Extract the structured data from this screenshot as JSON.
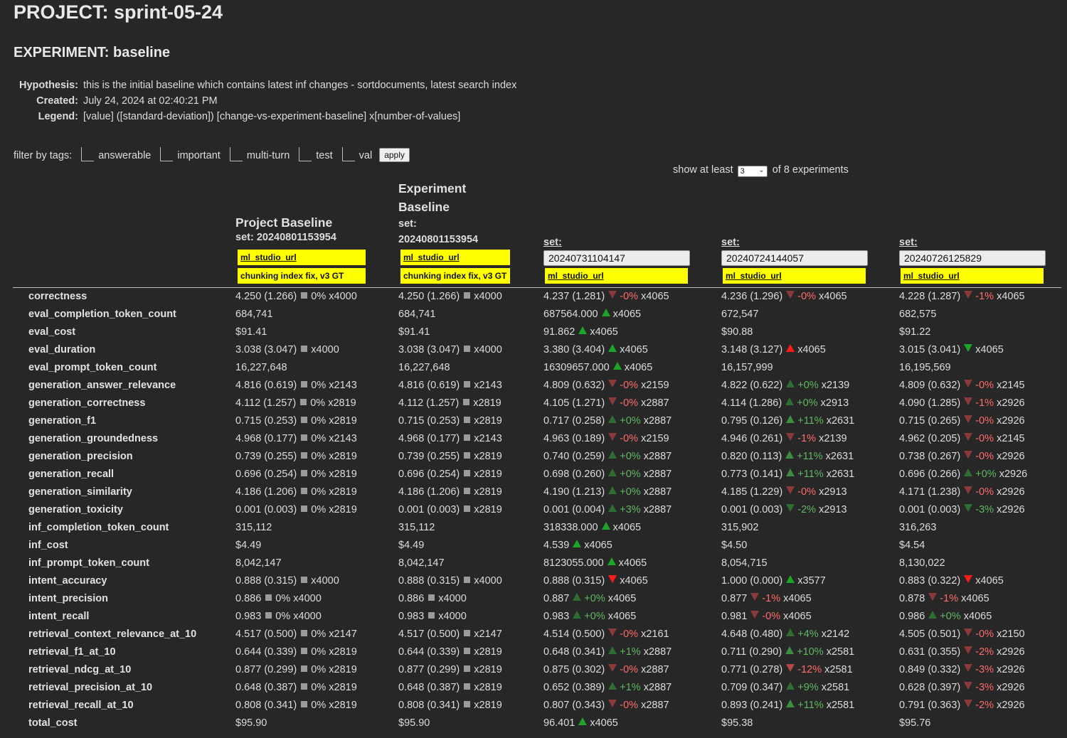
{
  "project": {
    "label": "PROJECT: sprint-05-24"
  },
  "experiment": {
    "label": "EXPERIMENT: baseline"
  },
  "meta": [
    {
      "key": "Hypothesis:",
      "value": "this is the initial baseline which contains latest inf changes - sortdocuments, latest search index"
    },
    {
      "key": "Created:",
      "value": "July 24, 2024 at 02:40:21 PM"
    },
    {
      "key": "Legend:",
      "value": "[value] ([standard-deviation]) [change-vs-experiment-baseline] x[number-of-values]"
    }
  ],
  "filter": {
    "label": "filter by tags:",
    "tags": [
      "answerable",
      "important",
      "multi-turn",
      "test",
      "val"
    ],
    "apply_label": "apply"
  },
  "show": {
    "prefix": "show at least",
    "selected": "3",
    "suffix": "of 8 experiments"
  },
  "columns": [
    {
      "title_line1": "Project Baseline",
      "title_line2": "",
      "set_label": "set: 20240801153954",
      "set_value": "",
      "url_label": "ml_studio_url",
      "note": "chunking index fix, v3 GT"
    },
    {
      "title_line1": "Experiment",
      "title_line2": "Baseline",
      "set_label": "set:",
      "set_value": "20240801153954",
      "url_label": "ml_studio_url",
      "note": "chunking index fix, v3 GT"
    },
    {
      "set_label": "set:",
      "set_value": "20240731104147",
      "url_label": "ml_studio_url"
    },
    {
      "set_label": "set:",
      "set_value": "20240724144057",
      "url_label": "ml_studio_url"
    },
    {
      "set_label": "set:",
      "set_value": "20240726125829",
      "url_label": "ml_studio_url"
    }
  ],
  "colors": {
    "background": "#272727",
    "yellow": "#ffff00",
    "green": "#1fa42a",
    "red": "#ff1a1a",
    "neutral": "#9b9b9b"
  },
  "rows": [
    {
      "metric": "correctness",
      "cells": [
        {
          "value": "4.250 (1.266)",
          "marker": "square",
          "pct": "0%",
          "count": "x4000"
        },
        {
          "value": "4.250 (1.266)",
          "marker": "square",
          "pct": "",
          "count": "x4000"
        },
        {
          "value": "4.237 (1.281)",
          "marker": "down-dim",
          "pct": "-0%",
          "count": "x4065"
        },
        {
          "value": "4.236 (1.296)",
          "marker": "down-dim",
          "pct": "-0%",
          "count": "x4065"
        },
        {
          "value": "4.228 (1.287)",
          "marker": "down-dim",
          "pct": "-1%",
          "count": "x4065"
        }
      ]
    },
    {
      "metric": "eval_completion_token_count",
      "cells": [
        {
          "value": "684,741"
        },
        {
          "value": "684,741"
        },
        {
          "value": "687564.000",
          "marker": "up-bright",
          "pct": "",
          "count": "x4065"
        },
        {
          "value": "672,547"
        },
        {
          "value": "682,575"
        }
      ]
    },
    {
      "metric": "eval_cost",
      "cells": [
        {
          "value": "$91.41"
        },
        {
          "value": "$91.41"
        },
        {
          "value": "91.862",
          "marker": "up-bright",
          "pct": "",
          "count": "x4065"
        },
        {
          "value": "$90.88"
        },
        {
          "value": "$91.22"
        }
      ]
    },
    {
      "metric": "eval_duration",
      "cells": [
        {
          "value": "3.038 (3.047)",
          "marker": "square",
          "pct": "",
          "count": "x4000"
        },
        {
          "value": "3.038 (3.047)",
          "marker": "square",
          "pct": "",
          "count": "x4000"
        },
        {
          "value": "3.380 (3.404)",
          "marker": "up-bright",
          "pct": "",
          "count": "x4065"
        },
        {
          "value": "3.148 (3.127)",
          "marker": "up-red",
          "pct": "",
          "count": "x4065"
        },
        {
          "value": "3.015 (3.041)",
          "marker": "down-green",
          "pct": "",
          "count": "x4065"
        }
      ]
    },
    {
      "metric": "eval_prompt_token_count",
      "cells": [
        {
          "value": "16,227,648"
        },
        {
          "value": "16,227,648"
        },
        {
          "value": "16309657.000",
          "marker": "up-bright",
          "pct": "",
          "count": "x4065"
        },
        {
          "value": "16,157,999"
        },
        {
          "value": "16,195,569"
        }
      ]
    },
    {
      "metric": "generation_answer_relevance",
      "cells": [
        {
          "value": "4.816 (0.619)",
          "marker": "square",
          "pct": "0%",
          "count": "x2143"
        },
        {
          "value": "4.816 (0.619)",
          "marker": "square",
          "pct": "",
          "count": "x2143"
        },
        {
          "value": "4.809 (0.632)",
          "marker": "down-dim",
          "pct": "-0%",
          "count": "x2159"
        },
        {
          "value": "4.822 (0.622)",
          "marker": "up-dim",
          "pct": "+0%",
          "count": "x2139"
        },
        {
          "value": "4.809 (0.632)",
          "marker": "down-dim",
          "pct": "-0%",
          "count": "x2145"
        }
      ]
    },
    {
      "metric": "generation_correctness",
      "cells": [
        {
          "value": "4.112 (1.257)",
          "marker": "square",
          "pct": "0%",
          "count": "x2819"
        },
        {
          "value": "4.112 (1.257)",
          "marker": "square",
          "pct": "",
          "count": "x2819"
        },
        {
          "value": "4.105 (1.271)",
          "marker": "down-dim",
          "pct": "-0%",
          "count": "x2887"
        },
        {
          "value": "4.114 (1.286)",
          "marker": "up-dim",
          "pct": "+0%",
          "count": "x2913"
        },
        {
          "value": "4.090 (1.285)",
          "marker": "down-dim",
          "pct": "-1%",
          "count": "x2926"
        }
      ]
    },
    {
      "metric": "generation_f1",
      "cells": [
        {
          "value": "0.715 (0.253)",
          "marker": "square",
          "pct": "0%",
          "count": "x2819"
        },
        {
          "value": "0.715 (0.253)",
          "marker": "square",
          "pct": "",
          "count": "x2819"
        },
        {
          "value": "0.717 (0.258)",
          "marker": "up-dim",
          "pct": "+0%",
          "count": "x2887"
        },
        {
          "value": "0.795 (0.126)",
          "marker": "up-mid",
          "pct": "+11%",
          "count": "x2631"
        },
        {
          "value": "0.715 (0.265)",
          "marker": "down-dim",
          "pct": "-0%",
          "count": "x2926"
        }
      ]
    },
    {
      "metric": "generation_groundedness",
      "cells": [
        {
          "value": "4.968 (0.177)",
          "marker": "square",
          "pct": "0%",
          "count": "x2143"
        },
        {
          "value": "4.968 (0.177)",
          "marker": "square",
          "pct": "",
          "count": "x2143"
        },
        {
          "value": "4.963 (0.189)",
          "marker": "down-dim",
          "pct": "-0%",
          "count": "x2159"
        },
        {
          "value": "4.946 (0.261)",
          "marker": "down-dim",
          "pct": "-1%",
          "count": "x2139"
        },
        {
          "value": "4.962 (0.205)",
          "marker": "down-dim",
          "pct": "-0%",
          "count": "x2145"
        }
      ]
    },
    {
      "metric": "generation_precision",
      "cells": [
        {
          "value": "0.739 (0.255)",
          "marker": "square",
          "pct": "0%",
          "count": "x2819"
        },
        {
          "value": "0.739 (0.255)",
          "marker": "square",
          "pct": "",
          "count": "x2819"
        },
        {
          "value": "0.740 (0.259)",
          "marker": "up-dim",
          "pct": "+0%",
          "count": "x2887"
        },
        {
          "value": "0.820 (0.113)",
          "marker": "up-mid",
          "pct": "+11%",
          "count": "x2631"
        },
        {
          "value": "0.738 (0.267)",
          "marker": "down-dim",
          "pct": "-0%",
          "count": "x2926"
        }
      ]
    },
    {
      "metric": "generation_recall",
      "cells": [
        {
          "value": "0.696 (0.254)",
          "marker": "square",
          "pct": "0%",
          "count": "x2819"
        },
        {
          "value": "0.696 (0.254)",
          "marker": "square",
          "pct": "",
          "count": "x2819"
        },
        {
          "value": "0.698 (0.260)",
          "marker": "up-dim",
          "pct": "+0%",
          "count": "x2887"
        },
        {
          "value": "0.773 (0.141)",
          "marker": "up-mid",
          "pct": "+11%",
          "count": "x2631"
        },
        {
          "value": "0.696 (0.266)",
          "marker": "up-dim",
          "pct": "+0%",
          "count": "x2926"
        }
      ]
    },
    {
      "metric": "generation_similarity",
      "cells": [
        {
          "value": "4.186 (1.206)",
          "marker": "square",
          "pct": "0%",
          "count": "x2819"
        },
        {
          "value": "4.186 (1.206)",
          "marker": "square",
          "pct": "",
          "count": "x2819"
        },
        {
          "value": "4.190 (1.213)",
          "marker": "up-dim",
          "pct": "+0%",
          "count": "x2887"
        },
        {
          "value": "4.185 (1.229)",
          "marker": "down-dim",
          "pct": "-0%",
          "count": "x2913"
        },
        {
          "value": "4.171 (1.238)",
          "marker": "down-dim",
          "pct": "-0%",
          "count": "x2926"
        }
      ]
    },
    {
      "metric": "generation_toxicity",
      "cells": [
        {
          "value": "0.001 (0.003)",
          "marker": "square",
          "pct": "0%",
          "count": "x2819"
        },
        {
          "value": "0.001 (0.003)",
          "marker": "square",
          "pct": "",
          "count": "x2819"
        },
        {
          "value": "0.001 (0.004)",
          "marker": "up-dim",
          "pct": "+3%",
          "count": "x2887"
        },
        {
          "value": "0.001 (0.003)",
          "marker": "down-green-dim",
          "pct": "-2%",
          "count": "x2913"
        },
        {
          "value": "0.001 (0.003)",
          "marker": "down-green-dim",
          "pct": "-3%",
          "count": "x2926"
        }
      ]
    },
    {
      "metric": "inf_completion_token_count",
      "cells": [
        {
          "value": "315,112"
        },
        {
          "value": "315,112"
        },
        {
          "value": "318338.000",
          "marker": "up-bright",
          "pct": "",
          "count": "x4065"
        },
        {
          "value": "315,902"
        },
        {
          "value": "316,263"
        }
      ]
    },
    {
      "metric": "inf_cost",
      "cells": [
        {
          "value": "$4.49"
        },
        {
          "value": "$4.49"
        },
        {
          "value": "4.539",
          "marker": "up-bright",
          "pct": "",
          "count": "x4065"
        },
        {
          "value": "$4.50"
        },
        {
          "value": "$4.54"
        }
      ]
    },
    {
      "metric": "inf_prompt_token_count",
      "cells": [
        {
          "value": "8,042,147"
        },
        {
          "value": "8,042,147"
        },
        {
          "value": "8123055.000",
          "marker": "up-bright",
          "pct": "",
          "count": "x4065"
        },
        {
          "value": "8,054,715"
        },
        {
          "value": "8,130,022"
        }
      ]
    },
    {
      "metric": "intent_accuracy",
      "cells": [
        {
          "value": "0.888 (0.315)",
          "marker": "square",
          "pct": "",
          "count": "x4000"
        },
        {
          "value": "0.888 (0.315)",
          "marker": "square",
          "pct": "",
          "count": "x4000"
        },
        {
          "value": "0.888 (0.315)",
          "marker": "down-red",
          "pct": "",
          "count": "x4065"
        },
        {
          "value": "1.000 (0.000)",
          "marker": "up-bright",
          "pct": "",
          "count": "x3577"
        },
        {
          "value": "0.883 (0.322)",
          "marker": "down-red",
          "pct": "",
          "count": "x4065"
        }
      ]
    },
    {
      "metric": "intent_precision",
      "cells": [
        {
          "value": "0.886",
          "marker": "square",
          "pct": "0%",
          "count": "x4000"
        },
        {
          "value": "0.886",
          "marker": "square",
          "pct": "",
          "count": "x4000"
        },
        {
          "value": "0.887",
          "marker": "up-dim",
          "pct": "+0%",
          "count": "x4065"
        },
        {
          "value": "0.877",
          "marker": "down-dim",
          "pct": "-1%",
          "count": "x4065"
        },
        {
          "value": "0.878",
          "marker": "down-dim",
          "pct": "-1%",
          "count": "x4065"
        }
      ]
    },
    {
      "metric": "intent_recall",
      "cells": [
        {
          "value": "0.983",
          "marker": "square",
          "pct": "0%",
          "count": "x4000"
        },
        {
          "value": "0.983",
          "marker": "square",
          "pct": "",
          "count": "x4000"
        },
        {
          "value": "0.983",
          "marker": "up-dim",
          "pct": "+0%",
          "count": "x4065"
        },
        {
          "value": "0.981",
          "marker": "down-dim",
          "pct": "-0%",
          "count": "x4065"
        },
        {
          "value": "0.986",
          "marker": "up-dim",
          "pct": "+0%",
          "count": "x4065"
        }
      ]
    },
    {
      "metric": "retrieval_context_relevance_at_10",
      "cells": [
        {
          "value": "4.517 (0.500)",
          "marker": "square",
          "pct": "0%",
          "count": "x2147"
        },
        {
          "value": "4.517 (0.500)",
          "marker": "square",
          "pct": "",
          "count": "x2147"
        },
        {
          "value": "4.514 (0.500)",
          "marker": "down-dim",
          "pct": "-0%",
          "count": "x2161"
        },
        {
          "value": "4.648 (0.480)",
          "marker": "up-dim",
          "pct": "+4%",
          "count": "x2142"
        },
        {
          "value": "4.505 (0.501)",
          "marker": "down-dim",
          "pct": "-0%",
          "count": "x2150"
        }
      ]
    },
    {
      "metric": "retrieval_f1_at_10",
      "cells": [
        {
          "value": "0.644 (0.339)",
          "marker": "square",
          "pct": "0%",
          "count": "x2819"
        },
        {
          "value": "0.644 (0.339)",
          "marker": "square",
          "pct": "",
          "count": "x2819"
        },
        {
          "value": "0.648 (0.341)",
          "marker": "up-dim",
          "pct": "+1%",
          "count": "x2887"
        },
        {
          "value": "0.711 (0.290)",
          "marker": "up-mid",
          "pct": "+10%",
          "count": "x2581"
        },
        {
          "value": "0.631 (0.355)",
          "marker": "down-dim",
          "pct": "-2%",
          "count": "x2926"
        }
      ]
    },
    {
      "metric": "retrieval_ndcg_at_10",
      "cells": [
        {
          "value": "0.877 (0.299)",
          "marker": "square",
          "pct": "0%",
          "count": "x2819"
        },
        {
          "value": "0.877 (0.299)",
          "marker": "square",
          "pct": "",
          "count": "x2819"
        },
        {
          "value": "0.875 (0.302)",
          "marker": "down-dim",
          "pct": "-0%",
          "count": "x2887"
        },
        {
          "value": "0.771 (0.278)",
          "marker": "down-mid",
          "pct": "-12%",
          "count": "x2581"
        },
        {
          "value": "0.849 (0.332)",
          "marker": "down-dim",
          "pct": "-3%",
          "count": "x2926"
        }
      ]
    },
    {
      "metric": "retrieval_precision_at_10",
      "cells": [
        {
          "value": "0.648 (0.387)",
          "marker": "square",
          "pct": "0%",
          "count": "x2819"
        },
        {
          "value": "0.648 (0.387)",
          "marker": "square",
          "pct": "",
          "count": "x2819"
        },
        {
          "value": "0.652 (0.389)",
          "marker": "up-dim",
          "pct": "+1%",
          "count": "x2887"
        },
        {
          "value": "0.709 (0.347)",
          "marker": "up-dim",
          "pct": "+9%",
          "count": "x2581"
        },
        {
          "value": "0.628 (0.397)",
          "marker": "down-dim",
          "pct": "-3%",
          "count": "x2926"
        }
      ]
    },
    {
      "metric": "retrieval_recall_at_10",
      "cells": [
        {
          "value": "0.808 (0.341)",
          "marker": "square",
          "pct": "0%",
          "count": "x2819"
        },
        {
          "value": "0.808 (0.341)",
          "marker": "square",
          "pct": "",
          "count": "x2819"
        },
        {
          "value": "0.807 (0.343)",
          "marker": "down-dim",
          "pct": "-0%",
          "count": "x2887"
        },
        {
          "value": "0.893 (0.241)",
          "marker": "up-mid",
          "pct": "+11%",
          "count": "x2581"
        },
        {
          "value": "0.791 (0.363)",
          "marker": "down-dim",
          "pct": "-2%",
          "count": "x2926"
        }
      ]
    },
    {
      "metric": "total_cost",
      "cells": [
        {
          "value": "$95.90"
        },
        {
          "value": "$95.90"
        },
        {
          "value": "96.401",
          "marker": "up-bright",
          "pct": "",
          "count": "x4065"
        },
        {
          "value": "$95.38"
        },
        {
          "value": "$95.76"
        }
      ]
    }
  ]
}
